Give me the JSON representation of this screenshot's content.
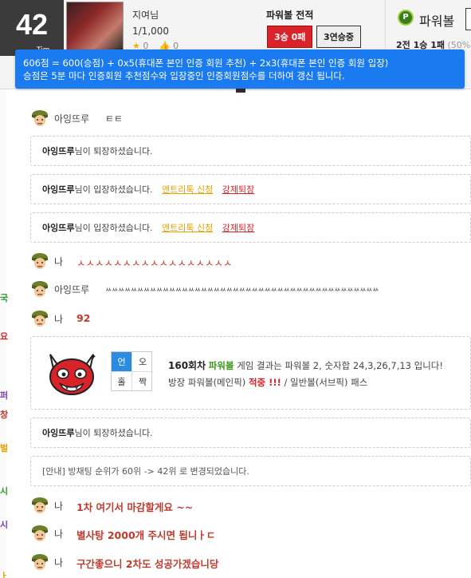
{
  "header": {
    "rank": "42",
    "nickname": "지여님",
    "level": "1/1,000",
    "stars": "0",
    "thumbs": "0",
    "record_title": "파워볼 전적",
    "record_loss": "3승 0패",
    "record_streak": "3연승중",
    "game_icon_letter": "P",
    "game_name": "파워볼",
    "game_stat": "2전 1승 1패",
    "game_pct": "(50%"
  },
  "tooltip": {
    "line1": "606점 = 600(승점) + 0x5(휴대폰 본인 인증 회원 추천) + 2x3(휴대폰 본인 인증 회원 입장)",
    "line2": "승점은 5분 마다 인증회원 추천점수와 입장중인 인증회원점수를 더하여 갱신 됩니다."
  },
  "messages": {
    "m1_user": "아잉뜨루",
    "m1_text": "ㅌㅌ",
    "s1_user": "아잉뜨루",
    "s1_text": "님이 퇴장하셨습니다.",
    "s2_user": "아잉뜨루",
    "s2_text": "님이 입장하셨습니다.",
    "s2_entry": "엔트리톡 신청",
    "s2_kick": "강제퇴장",
    "s3_user": "아잉뜨루",
    "s3_text": "님이 입장하셨습니다.",
    "s3_entry": "엔트리톡 신청",
    "s3_kick": "강제퇴장",
    "m2_user": "나",
    "m2_text": "ㅅㅅㅅㅅㅅㅅㅅㅅㅅㅅㅅㅅㅅㅅㅅㅅㅅ",
    "m3_user": "아잉뜨루",
    "m3_text": "ㅆㅆㅆㅆㅆㅆㅆㅆㅆㅆㅆㅆㅆㅆㅆㅆㅆㅆㅆㅆㅆㅆㅆㅆㅆㅆㅆㅆㅆㅆㅆㅆㅆㅆㅆㅆㅆㅆㅆㅆㅆㅆㅆ",
    "m4_user": "나",
    "m4_text": "92",
    "s4_user": "아잉뜨루",
    "s4_text": "님이 퇴장하셨습니다.",
    "notice": "[안내] 방채팅 순위가 60위 -> 42위 로 변경되었습니다.",
    "m5_user": "나",
    "m5_text": "1차 여기서 마감할게요 ~~",
    "m6_user": "나",
    "m6_text": "별사탕 2000개 주시면 됩니ㅏㄷ",
    "m7_user": "나",
    "m7_text": "구간좋으니 2차도 성공가겠습니당"
  },
  "game_result": {
    "cells": [
      "언",
      "오",
      "홀",
      "짝"
    ],
    "round": "160회차",
    "game": "파워볼",
    "result_text": "게임 결과는 파워볼 2, 숫자합 24,3,26,7,13 입니다!",
    "pick_prefix": "방장 파워볼(메인픽)",
    "pick_hit": "적중 !!!",
    "pick_sep": "/ 일반볼(서브픽)",
    "pick_pass": "패스"
  },
  "colors": {
    "accent": "#1a7af0",
    "red": "#d8232a",
    "message_red": "#c0392b",
    "orange_link": "#e5a100",
    "green": "#3a9a1a"
  }
}
